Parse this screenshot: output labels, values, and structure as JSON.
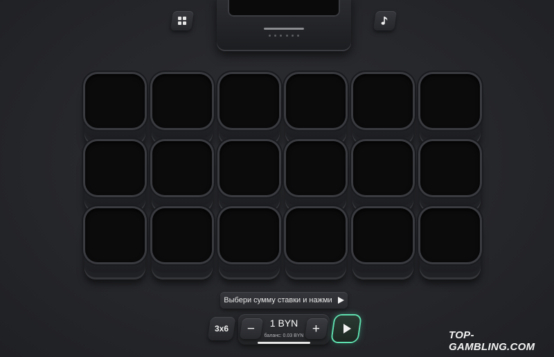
{
  "header": {
    "menu_icon": "grid-icon",
    "music_icon": "music-note-icon"
  },
  "board": {
    "rows": 3,
    "cols": 6,
    "tiles": [
      "",
      "",
      "",
      "",
      "",
      "",
      "",
      "",
      "",
      "",
      "",
      "",
      "",
      "",
      "",
      "",
      "",
      ""
    ]
  },
  "controls": {
    "hint_text": "Выбери сумму ставки и нажми",
    "grid_size_label": "3x6",
    "minus_label": "−",
    "plus_label": "+",
    "bet_value": "1 BYN",
    "balance_text": "баланс: 0.03 BYN",
    "play_icon": "play-icon"
  },
  "watermark": "TOP-GAMBLING.COM",
  "colors": {
    "accent": "#5fe0b0",
    "background": "#26272b"
  }
}
